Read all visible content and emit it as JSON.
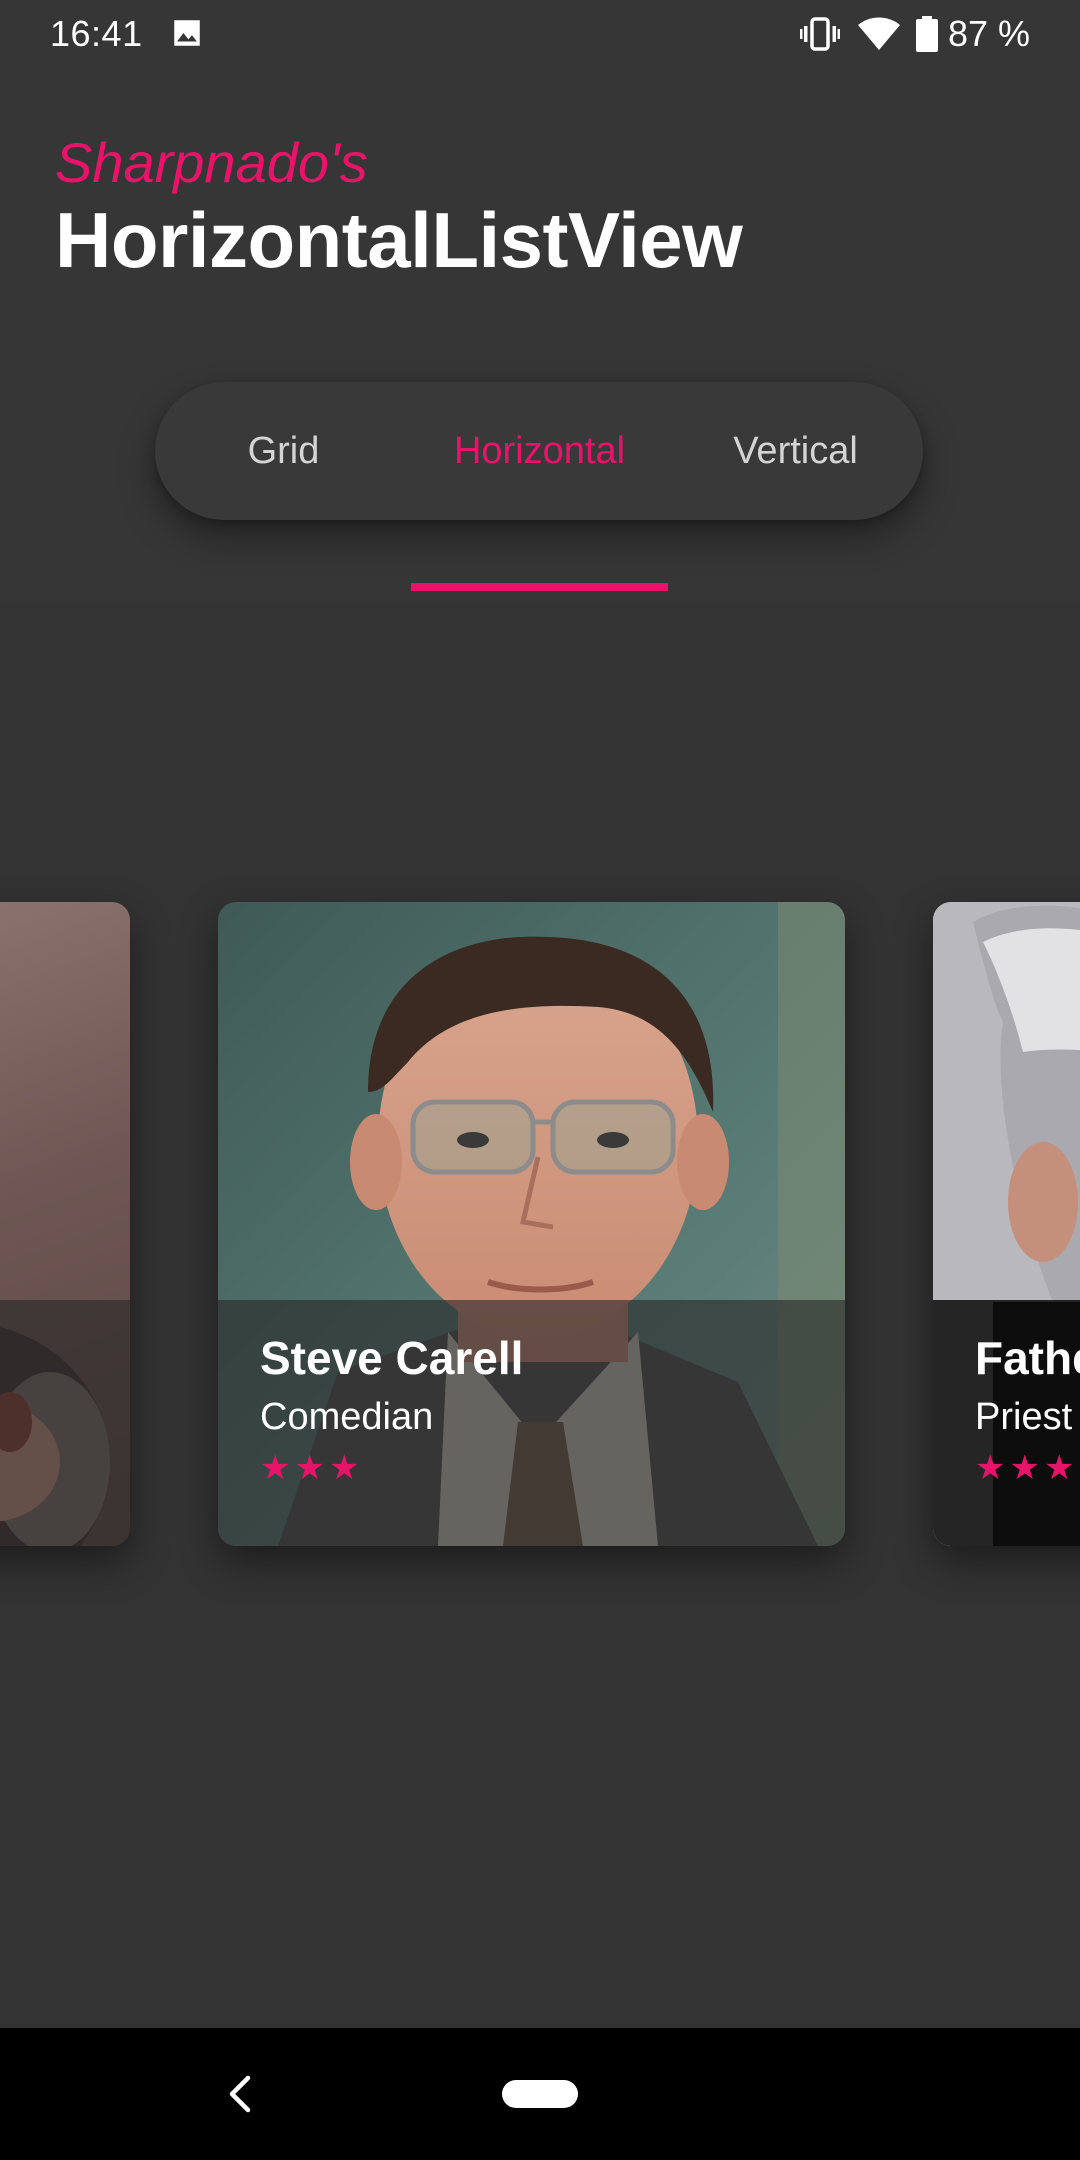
{
  "status_bar": {
    "time": "16:41",
    "battery": "87 %",
    "icons": [
      "image-icon",
      "vibrate-icon",
      "wifi-icon",
      "battery-icon"
    ]
  },
  "header": {
    "subtitle": "Sharpnado's",
    "title": "HorizontalListView"
  },
  "tabs": {
    "items": [
      {
        "label": "Grid",
        "selected": false
      },
      {
        "label": "Horizontal",
        "selected": true
      },
      {
        "label": "Vertical",
        "selected": false
      }
    ]
  },
  "cards": [
    {
      "name": "",
      "role": "",
      "stars": ""
    },
    {
      "name": "Steve Carell",
      "role": "Comedian",
      "stars": "★★★"
    },
    {
      "name": "Fathe",
      "role": "Priest",
      "stars": "★★★"
    }
  ],
  "colors": {
    "accent": "#e8146a",
    "background": "#333333",
    "header_background": "#363636",
    "tab_text": "#d4d4d4"
  },
  "nav_bar": {
    "icons": [
      "back-icon",
      "home-pill-icon"
    ]
  }
}
